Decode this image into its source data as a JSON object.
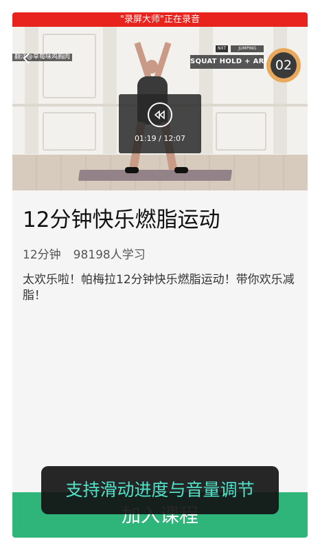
{
  "recording_banner": "\"录屏大师\"正在录音",
  "video": {
    "watermark": "翻洋@草莓味鸡胸肉",
    "next_tag": "NXT",
    "next_exercise": "JUMPING JACK",
    "current_exercise": "SQUAT HOLD + ARMS",
    "counter": "02",
    "time": "01:19 / 12:07",
    "icons": [
      "back-icon",
      "rewind-icon"
    ]
  },
  "course": {
    "title": "12分钟快乐燃脂运动",
    "duration": "12分钟",
    "learners": "98198人学习",
    "description": "太欢乐啦！帕梅拉12分钟快乐燃脂运动！带你欢乐减脂！"
  },
  "join_button": "加入课程",
  "toast": "支持滑动进度与音量调节",
  "colors": {
    "recording_bar": "#e8231e",
    "accent_green": "#2fb57a",
    "toast_text": "#4fe3c9",
    "counter_ring": "#e8a95d"
  }
}
